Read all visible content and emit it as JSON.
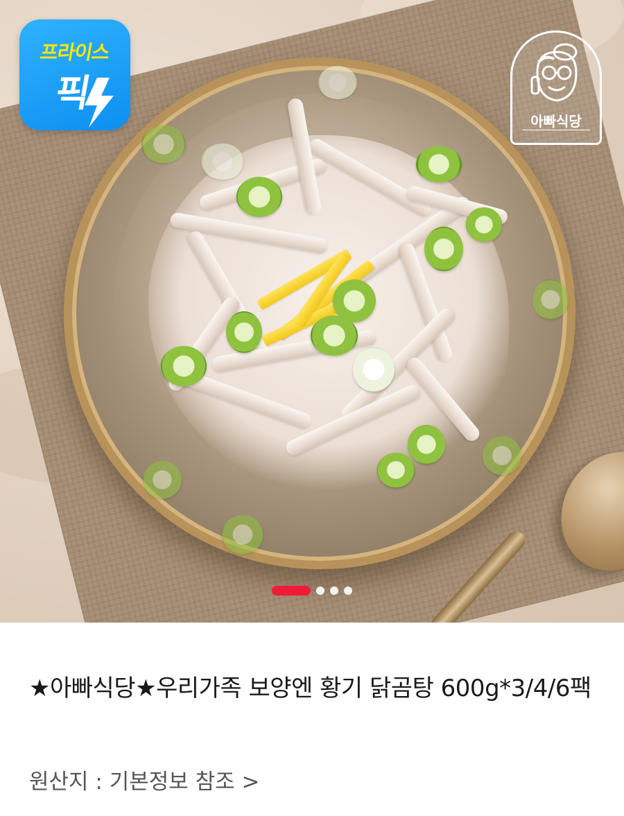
{
  "badges": {
    "price_pick": {
      "line1": "프라이스",
      "line2": "픽",
      "bg_color": "#1aa3fb",
      "text_color": "#ffe600",
      "icon": "lightning-bolt-icon"
    },
    "brand": {
      "name": "아빠식당",
      "icon": "chef-character-icon"
    }
  },
  "carousel": {
    "current_page": 1,
    "total_pages": 4,
    "active_color": "#f21b37"
  },
  "product": {
    "title": "★아빠식당★우리가족 보양엔 황기 닭곰탕 600g*3/4/6팩",
    "origin_label": "원산지 : 기본정보 참조 >"
  }
}
